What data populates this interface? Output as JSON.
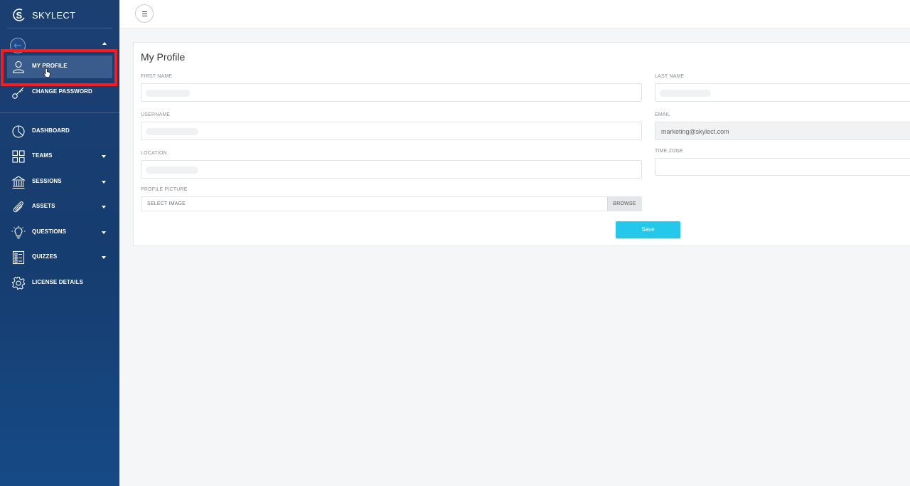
{
  "brand": {
    "name": "SKYLECT"
  },
  "sidebar": {
    "account_items": [
      {
        "label": "MY PROFILE",
        "icon": "user-icon"
      },
      {
        "label": "CHANGE PASSWORD",
        "icon": "key-icon"
      }
    ],
    "items": [
      {
        "label": "DASHBOARD",
        "icon": "pie-chart-icon"
      },
      {
        "label": "TEAMS",
        "icon": "grid-icon"
      },
      {
        "label": "SESSIONS",
        "icon": "bank-icon"
      },
      {
        "label": "ASSETS",
        "icon": "paperclip-icon"
      },
      {
        "label": "QUESTIONS",
        "icon": "lightbulb-icon"
      },
      {
        "label": "QUIZZES",
        "icon": "quiz-icon"
      },
      {
        "label": "LICENSE DETAILS",
        "icon": "gear-icon"
      }
    ]
  },
  "page": {
    "title": "My Profile",
    "fields": {
      "first_name": {
        "label": "FIRST NAME",
        "value": ""
      },
      "last_name": {
        "label": "LAST NAME",
        "value": ""
      },
      "username": {
        "label": "USERNAME",
        "value": ""
      },
      "email": {
        "label": "EMAIL",
        "value": "marketing@skylect.com"
      },
      "location": {
        "label": "LOCATION",
        "value": ""
      },
      "time_zone": {
        "label": "TIME ZONE",
        "value": ""
      },
      "profile_picture": {
        "label": "PROFILE PICTURE",
        "placeholder": "SELECT IMAGE",
        "browse_label": "BROWSE"
      }
    },
    "save_label": "Save"
  },
  "colors": {
    "sidebar_bg": "#1c3f72",
    "accent": "#25c8ea",
    "highlight": "#ff1a1a"
  }
}
